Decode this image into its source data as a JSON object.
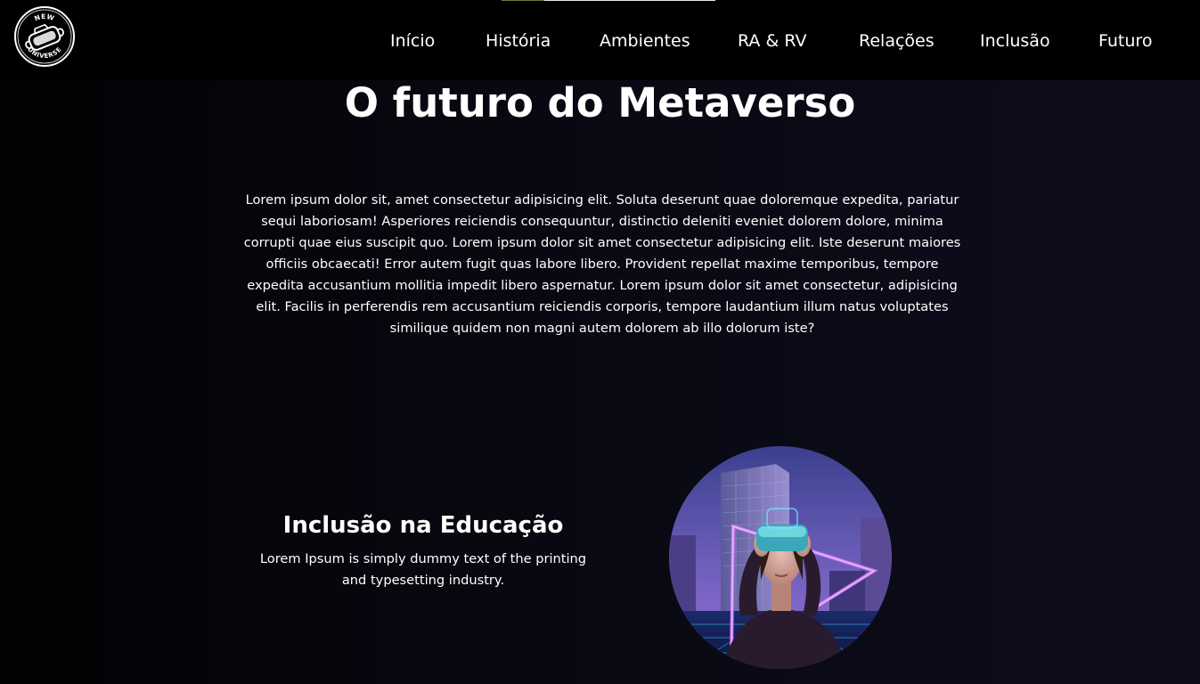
{
  "header": {
    "logo": {
      "top_text": "NEW",
      "bottom_text": "UNIVERSE",
      "icon": "vr-headset-icon"
    },
    "nav": [
      {
        "label": "Início"
      },
      {
        "label": "História"
      },
      {
        "label": "Ambientes"
      },
      {
        "label": "RA & RV"
      },
      {
        "label": "Relações"
      },
      {
        "label": "Inclusão"
      },
      {
        "label": "Futuro"
      }
    ]
  },
  "main": {
    "title": "O futuro do Metaverso",
    "intro": "Lorem ipsum dolor sit, amet consectetur adipisicing elit. Soluta deserunt quae doloremque expedita, pariatur sequi laboriosam! Asperiores reiciendis consequuntur, distinctio deleniti eveniet dolorem dolore, minima corrupti quae eius suscipit quo. Lorem ipsum dolor sit amet consectetur adipisicing elit. Iste deserunt maiores officiis obcaecati! Error autem fugit quas labore libero. Provident repellat maxime temporibus, tempore expedita accusantium mollitia impedit libero aspernatur. Lorem ipsum dolor sit amet consectetur, adipisicing elit. Facilis in perferendis rem accusantium reiciendis corporis, tempore laudantium illum natus voluptates similique quidem non magni autem dolorem ab illo dolorum iste?"
  },
  "feature": {
    "title": "Inclusão na Educação",
    "text": "Lorem Ipsum is simply dummy text of the printing and typesetting industry.",
    "image": "woman-vr-headset-city-photo"
  },
  "colors": {
    "background": "#000000",
    "text": "#ffffff",
    "neon_accent": "#c86bff"
  }
}
